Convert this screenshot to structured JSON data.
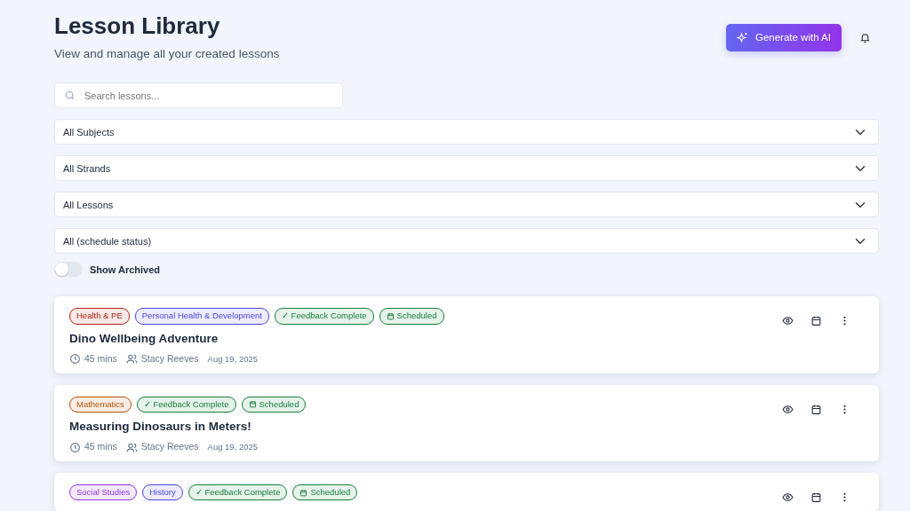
{
  "header": {
    "title": "Lesson Library",
    "subtitle": "View and manage all your created lessons",
    "generate_button": "Generate with AI"
  },
  "search": {
    "placeholder": "Search lessons..."
  },
  "filters": [
    {
      "value": "All Subjects"
    },
    {
      "value": "All Strands"
    },
    {
      "value": "All Lessons"
    },
    {
      "value": "All (schedule status)"
    }
  ],
  "show_archived": {
    "label": "Show Archived",
    "on": false
  },
  "lessons": [
    {
      "tags": [
        {
          "kind": "subject",
          "label": "Health & PE",
          "color": "#b42318"
        },
        {
          "kind": "strand",
          "label": "Personal Health & Development",
          "color": "#4f46e5"
        },
        {
          "kind": "feedback",
          "label": "✓ Feedback Complete",
          "color": "#15803d"
        },
        {
          "kind": "scheduled",
          "label": "Scheduled",
          "color": "#15803d"
        }
      ],
      "title": "Dino Wellbeing Adventure",
      "duration": "45 mins",
      "author": "Stacy Reeves",
      "date": "Aug 19, 2025"
    },
    {
      "tags": [
        {
          "kind": "subject",
          "label": "Mathematics",
          "color": "#b45309"
        },
        {
          "kind": "feedback",
          "label": "✓ Feedback Complete",
          "color": "#15803d"
        },
        {
          "kind": "scheduled",
          "label": "Scheduled",
          "color": "#15803d"
        }
      ],
      "title": "Measuring Dinosaurs in Meters!",
      "duration": "45 mins",
      "author": "Stacy Reeves",
      "date": "Aug 19, 2025"
    },
    {
      "tags": [
        {
          "kind": "subject",
          "label": "Social Studies",
          "color": "#9333ea"
        },
        {
          "kind": "strand",
          "label": "History",
          "color": "#4f46e5"
        },
        {
          "kind": "feedback",
          "label": "✓ Feedback Complete",
          "color": "#15803d"
        },
        {
          "kind": "scheduled",
          "label": "Scheduled",
          "color": "#15803d"
        }
      ]
    }
  ]
}
